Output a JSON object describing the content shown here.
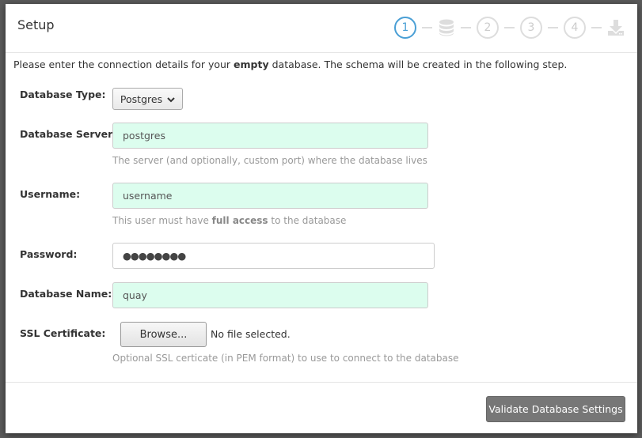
{
  "modal": {
    "title": "Setup",
    "steps": [
      {
        "label": "1",
        "type": "number",
        "state": "active"
      },
      {
        "label": "database",
        "type": "icon",
        "icon": "database-icon",
        "state": "inactive"
      },
      {
        "label": "2",
        "type": "number",
        "state": "inactive"
      },
      {
        "label": "3",
        "type": "number",
        "state": "inactive"
      },
      {
        "label": "4",
        "type": "number",
        "state": "inactive"
      },
      {
        "label": "download",
        "type": "icon",
        "icon": "download-icon",
        "state": "inactive"
      }
    ],
    "colors": {
      "active_step": "#4a9fd5",
      "inactive_step": "#dddddd",
      "valid_field_bg": "#dcfdee",
      "primary_button": "#777777"
    }
  },
  "intro": {
    "before": "Please enter the connection details for your ",
    "bold": "empty",
    "after": " database. The schema will be created in the following step."
  },
  "form": {
    "database_type": {
      "label": "Database Type:",
      "value": "Postgres"
    },
    "database_server": {
      "label": "Database Server:",
      "value": "postgres",
      "help": "The server (and optionally, custom port) where the database lives"
    },
    "username": {
      "label": "Username:",
      "value": "username",
      "help_before": "This user must have ",
      "help_bold": "full access",
      "help_after": " to the database"
    },
    "password": {
      "label": "Password:",
      "value": "●●●●●●●●"
    },
    "database_name": {
      "label": "Database Name:",
      "value": "quay"
    },
    "ssl_certificate": {
      "label": "SSL Certificate:",
      "browse_label": "Browse...",
      "file_status": "No file selected.",
      "help": "Optional SSL certicate (in PEM format) to use to connect to the database"
    }
  },
  "footer": {
    "validate_label": "Validate Database Settings"
  }
}
